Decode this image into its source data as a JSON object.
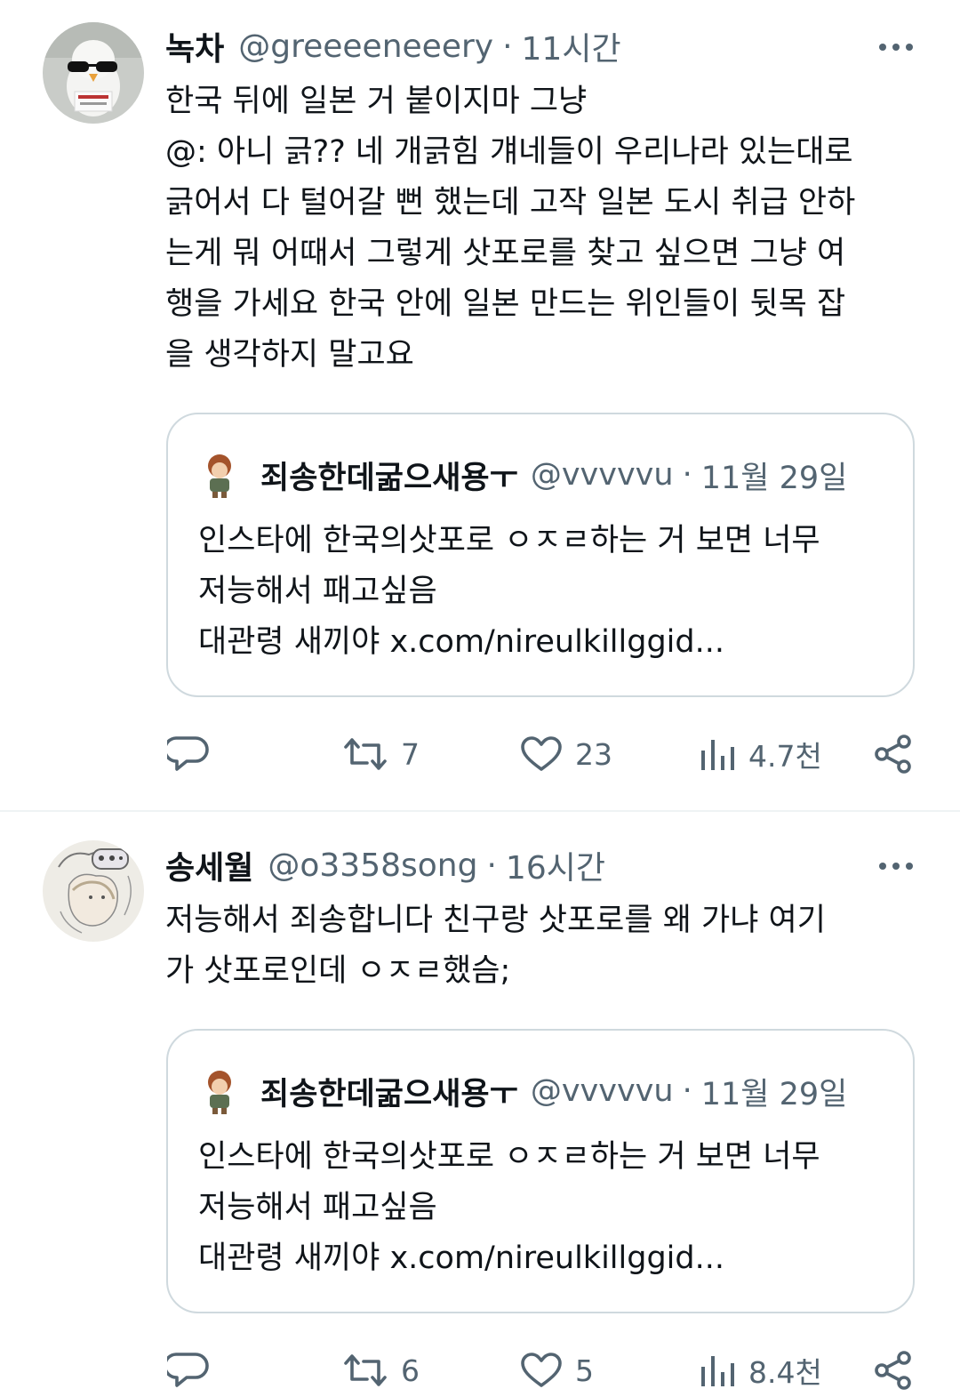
{
  "tweets": [
    {
      "author_name": "녹차",
      "handle": "@greeeeneeery",
      "separator": "·",
      "time": "11시간",
      "lines": [
        "한국 뒤에 일본 거 붙이지마 그냥",
        "@: 아니 긁?? 네 개긁힘 걔네들이 우리나라 있는대로",
        "긁어서 다 털어갈 뻔 했는데 고작 일본 도시 취급 안하",
        "는게 뭐 어때서 그렇게 삿포로를 찾고 싶으면 그냥 여",
        "행을 가세요 한국 안에 일본 만드는 위인들이 뒷목 잡",
        "을 생각하지 말고요"
      ],
      "quote": {
        "author_name": "죄송한데굶으새용ㅜ",
        "handle": "@vvvvvu",
        "separator": "·",
        "time": "11월 29일",
        "lines": [
          "인스타에 한국의삿포로 ㅇㅈㄹ하는 거 보면 너무",
          "저능해서 패고싶음",
          "대관령 새끼야 x.com/nireulkillggid..."
        ]
      },
      "actions": {
        "reply": "",
        "retweet": "7",
        "like": "23",
        "views": "4.7천"
      }
    },
    {
      "author_name": "송세월",
      "handle": "@o3358song",
      "separator": "·",
      "time": "16시간",
      "lines": [
        "저능해서 죄송합니다 친구랑 삿포로를 왜 가냐 여기",
        "가 삿포로인데 ㅇㅈㄹ했슴;"
      ],
      "quote": {
        "author_name": "죄송한데굶으새용ㅜ",
        "handle": "@vvvvvu",
        "separator": "·",
        "time": "11월 29일",
        "lines": [
          "인스타에 한국의삿포로 ㅇㅈㄹ하는 거 보면 너무",
          "저능해서 패고싶음",
          "대관령 새끼야 x.com/nireulkillggid..."
        ]
      },
      "actions": {
        "reply": "",
        "retweet": "6",
        "like": "5",
        "views": "8.4천"
      }
    }
  ],
  "colors": {
    "text": "#0f1419",
    "secondary": "#536471",
    "border": "#cfd9de",
    "divider": "#eff3f4"
  },
  "icons": [
    "more-icon",
    "reply-icon",
    "retweet-icon",
    "like-icon",
    "views-icon",
    "share-icon"
  ]
}
